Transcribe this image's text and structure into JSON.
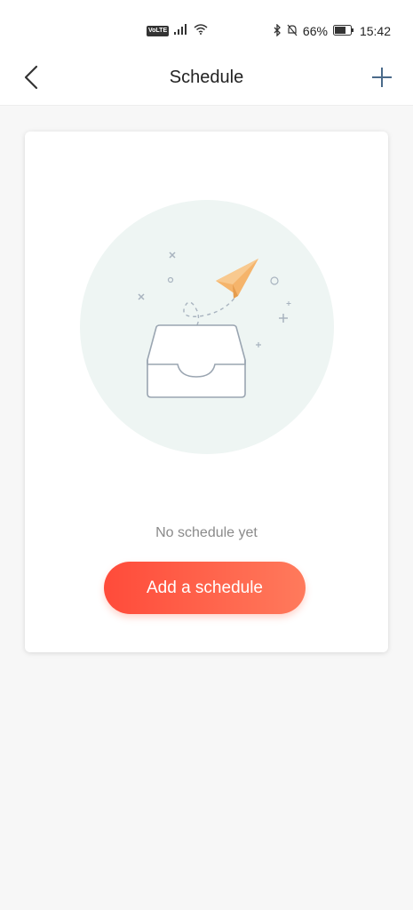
{
  "status_bar": {
    "network_badge": "VoLTE",
    "battery_percent": "66%",
    "time": "15:42",
    "icons": [
      "signal-icon",
      "wifi-icon",
      "bluetooth-icon",
      "mute-bell-icon",
      "battery-icon"
    ]
  },
  "header": {
    "title": "Schedule",
    "back_icon": "chevron-left-icon",
    "add_icon": "plus-icon"
  },
  "empty_state": {
    "message": "No schedule yet",
    "illustration_icon": "paper-plane-inbox-icon"
  },
  "actions": {
    "add_schedule_label": "Add a schedule"
  },
  "colors": {
    "accent_start": "#ff4b3a",
    "accent_end": "#ff7a5c",
    "header_icon": "#4a6a8a",
    "plane": "#f5b46b",
    "circle_bg": "#eef5f3"
  }
}
